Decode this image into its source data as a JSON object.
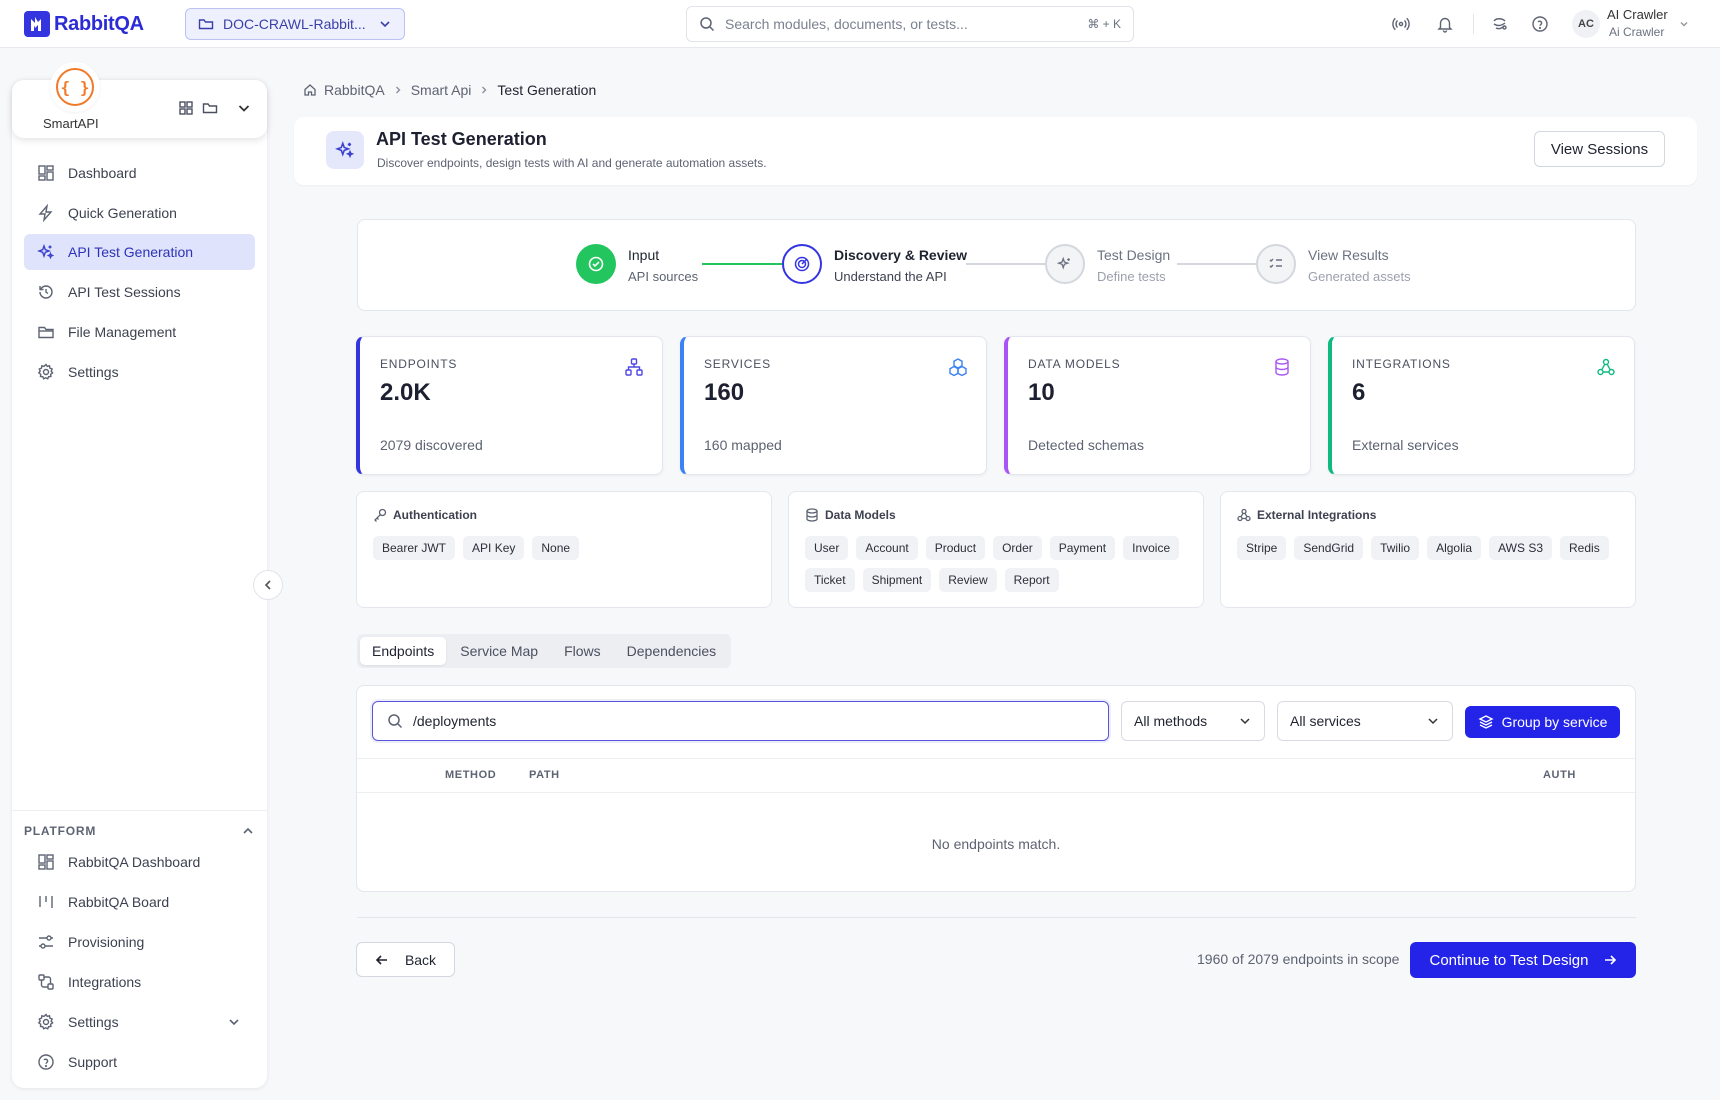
{
  "app": {
    "name": "RabbitQA",
    "project": "DOC-CRAWL-Rabbit..."
  },
  "search": {
    "placeholder": "Search modules, documents, or tests...",
    "shortcut": "⌘ + K"
  },
  "user": {
    "initials": "AC",
    "name": "AI Crawler",
    "subtitle": "Ai Crawler"
  },
  "sidebar": {
    "module_name": "SmartAPI",
    "module_glyph": "{ }",
    "items": [
      {
        "label": "Dashboard",
        "icon": "dashboard-icon"
      },
      {
        "label": "Quick Generation",
        "icon": "lightning-icon"
      },
      {
        "label": "API Test Generation",
        "icon": "sparkles-icon",
        "active": true
      },
      {
        "label": "API Test Sessions",
        "icon": "history-icon"
      },
      {
        "label": "File Management",
        "icon": "folder-icon"
      },
      {
        "label": "Settings",
        "icon": "gear-icon"
      }
    ],
    "platform_heading": "PLATFORM",
    "platform_items": [
      {
        "label": "RabbitQA Dashboard",
        "icon": "dashboard-icon"
      },
      {
        "label": "RabbitQA Board",
        "icon": "board-icon"
      },
      {
        "label": "Provisioning",
        "icon": "sliders-icon"
      },
      {
        "label": "Integrations",
        "icon": "integrations-icon"
      },
      {
        "label": "Settings",
        "icon": "gear-icon"
      },
      {
        "label": "Support",
        "icon": "help-icon"
      }
    ]
  },
  "breadcrumb": [
    "RabbitQA",
    "Smart Api",
    "Test Generation"
  ],
  "header": {
    "title": "API Test Generation",
    "subtitle": "Discover endpoints, design tests with AI and generate automation assets.",
    "view_sessions": "View Sessions"
  },
  "stepper": [
    {
      "title": "Input",
      "subtitle": "API sources",
      "state": "done"
    },
    {
      "title": "Discovery & Review",
      "subtitle": "Understand the API",
      "state": "current"
    },
    {
      "title": "Test Design",
      "subtitle": "Define tests",
      "state": "pending"
    },
    {
      "title": "View Results",
      "subtitle": "Generated assets",
      "state": "pending"
    }
  ],
  "stats": [
    {
      "label": "ENDPOINTS",
      "value": "2.0K",
      "sub": "2079 discovered",
      "color": "#3535e0",
      "icon": "hierarchy-icon"
    },
    {
      "label": "SERVICES",
      "value": "160",
      "sub": "160 mapped",
      "color": "#3b82f6",
      "icon": "boxes-icon"
    },
    {
      "label": "DATA MODELS",
      "value": "10",
      "sub": "Detected schemas",
      "color": "#a855f7",
      "icon": "database-icon"
    },
    {
      "label": "INTEGRATIONS",
      "value": "6",
      "sub": "External services",
      "color": "#10b981",
      "icon": "webhook-icon"
    }
  ],
  "info_cards": [
    {
      "title": "Authentication",
      "icon": "key-icon",
      "chips": [
        "Bearer JWT",
        "API Key",
        "None"
      ]
    },
    {
      "title": "Data Models",
      "icon": "database-icon",
      "chips": [
        "User",
        "Account",
        "Product",
        "Order",
        "Payment",
        "Invoice",
        "Ticket",
        "Shipment",
        "Review",
        "Report"
      ]
    },
    {
      "title": "External Integrations",
      "icon": "webhook-icon",
      "chips": [
        "Stripe",
        "SendGrid",
        "Twilio",
        "Algolia",
        "AWS S3",
        "Redis"
      ]
    }
  ],
  "tabs": [
    "Endpoints",
    "Service Map",
    "Flows",
    "Dependencies"
  ],
  "filters": {
    "search_value": "/deployments",
    "methods": "All methods",
    "services": "All services",
    "group_button": "Group by service"
  },
  "table": {
    "columns": [
      "METHOD",
      "PATH",
      "AUTH"
    ],
    "empty": "No endpoints match."
  },
  "footer": {
    "back": "Back",
    "scope": "1960 of 2079 endpoints in scope",
    "continue": "Continue to Test Design"
  }
}
